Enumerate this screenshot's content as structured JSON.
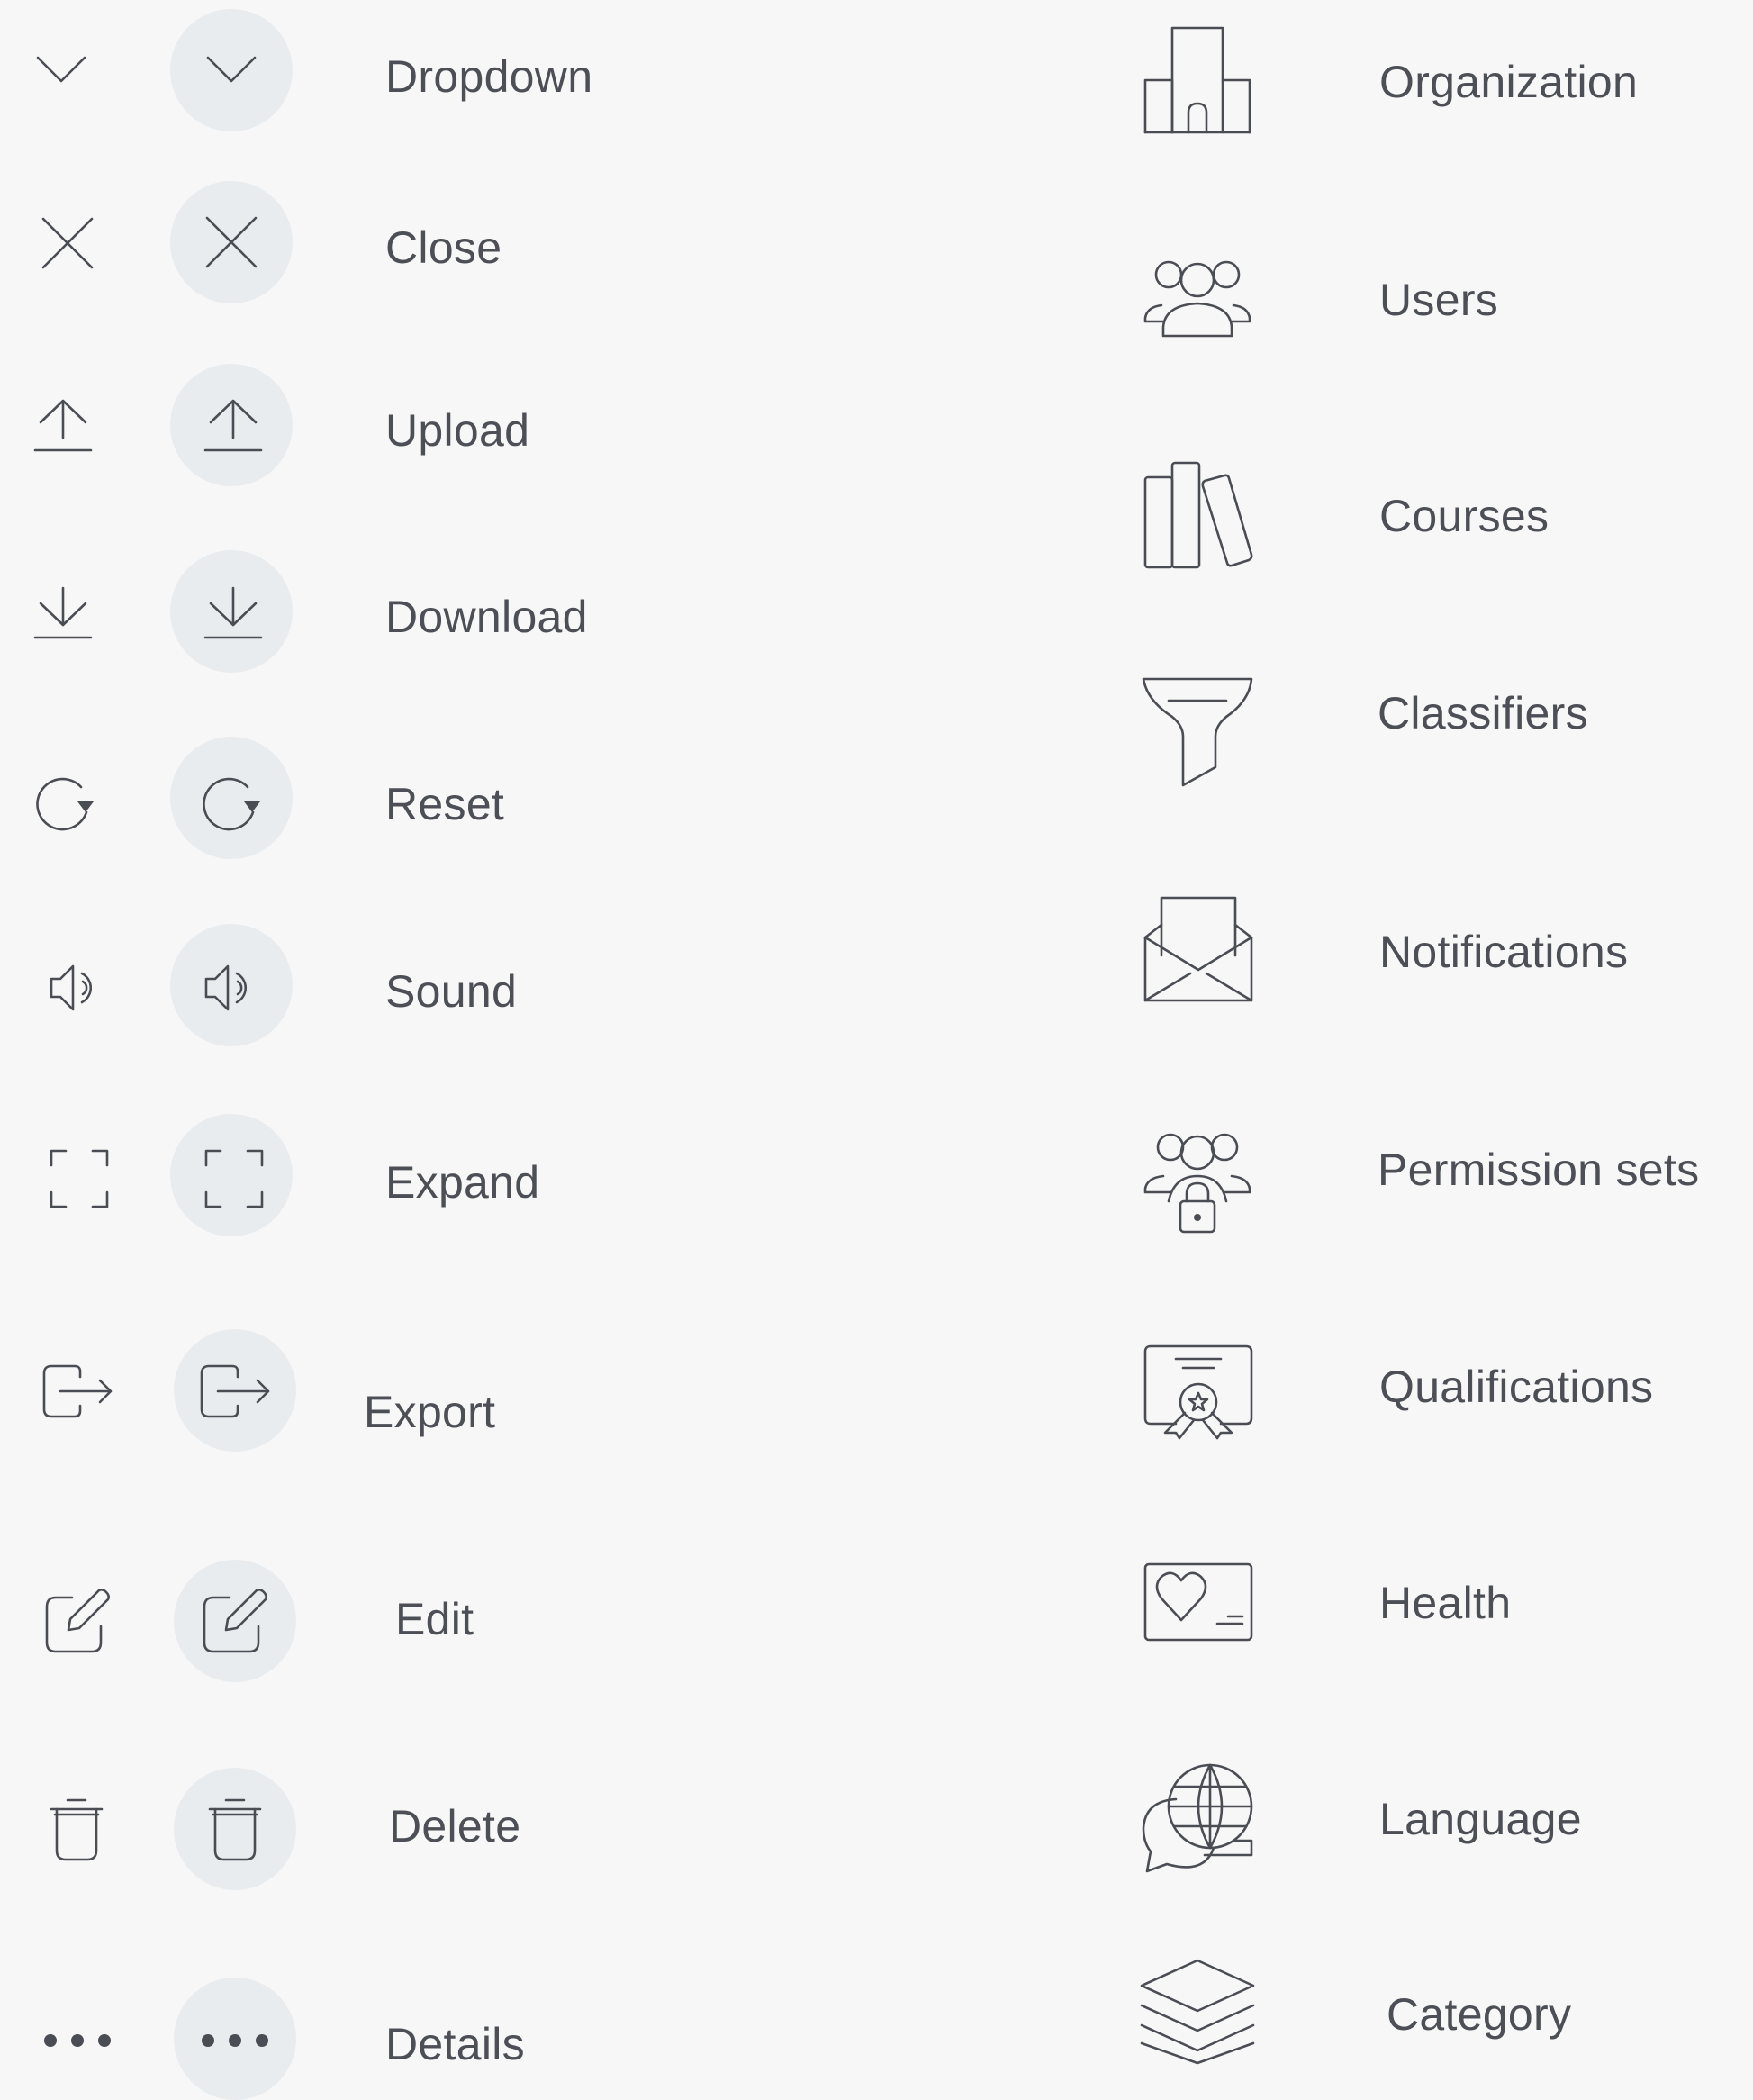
{
  "left_icons": [
    {
      "name": "Dropdown",
      "icon": "chevron-down-icon"
    },
    {
      "name": "Close",
      "icon": "close-icon"
    },
    {
      "name": "Upload",
      "icon": "upload-icon"
    },
    {
      "name": "Download",
      "icon": "download-icon"
    },
    {
      "name": "Reset",
      "icon": "reset-icon"
    },
    {
      "name": "Sound",
      "icon": "sound-icon"
    },
    {
      "name": "Expand",
      "icon": "expand-icon"
    },
    {
      "name": "Export",
      "icon": "export-icon"
    },
    {
      "name": "Edit",
      "icon": "edit-icon"
    },
    {
      "name": "Delete",
      "icon": "trash-icon"
    },
    {
      "name": "Details",
      "icon": "more-dots-icon"
    }
  ],
  "right_icons": [
    {
      "name": "Organization",
      "icon": "building-icon"
    },
    {
      "name": "Users",
      "icon": "users-icon"
    },
    {
      "name": "Courses",
      "icon": "books-icon"
    },
    {
      "name": "Classifiers",
      "icon": "funnel-icon"
    },
    {
      "name": "Notifications",
      "icon": "envelope-icon"
    },
    {
      "name": "Permission sets",
      "icon": "users-lock-icon"
    },
    {
      "name": "Qualifications",
      "icon": "certificate-icon"
    },
    {
      "name": "Health",
      "icon": "health-card-icon"
    },
    {
      "name": "Language",
      "icon": "globe-chat-icon"
    },
    {
      "name": "Category",
      "icon": "layers-icon"
    }
  ],
  "colors": {
    "background": "#f7f7f7",
    "circle": "#e9ecef",
    "stroke": "#4a4d54",
    "text": "#4c4f56"
  }
}
